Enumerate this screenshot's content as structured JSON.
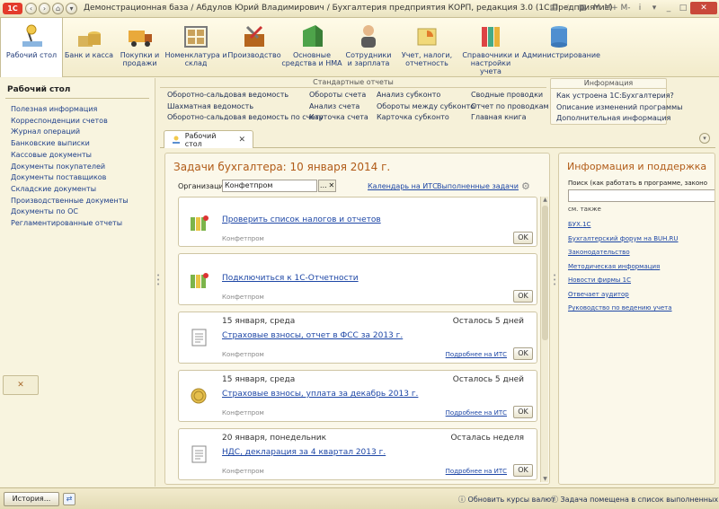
{
  "window": {
    "title": "Демонстрационная база / Абдулов Юрий Владимирович / Бухгалтерия предприятия КОРП, редакция 3.0  (1С:Предприятие)",
    "logo": "1С"
  },
  "sections": [
    {
      "label": "Рабочий стол",
      "icon": "desk-lamp-icon"
    },
    {
      "label": "Банк и касса",
      "icon": "bank-icon"
    },
    {
      "label": "Покупки и продажи",
      "icon": "truck-icon"
    },
    {
      "label": "Номенклатура и склад",
      "icon": "warehouse-icon"
    },
    {
      "label": "Производство",
      "icon": "tools-icon"
    },
    {
      "label": "Основные средства и НМА",
      "icon": "building-icon"
    },
    {
      "label": "Сотрудники и зарплата",
      "icon": "employee-icon"
    },
    {
      "label": "Учет, налоги, отчетность",
      "icon": "pie-chart-icon"
    },
    {
      "label": "Справочники и настройки учета",
      "icon": "books-icon"
    },
    {
      "label": "Администрирование",
      "icon": "database-icon"
    }
  ],
  "left_panel": {
    "title": "Рабочий стол",
    "items": [
      "Полезная информация",
      "Корреспонденции счетов",
      "Журнал операций",
      "Банковские выписки",
      "Кассовые документы",
      "Документы покупателей",
      "Документы поставщиков",
      "Складские документы",
      "Производственные документы",
      "Документы по ОС",
      "Регламентированные отчеты"
    ],
    "close_glyph": "✕"
  },
  "reports": {
    "title": "Стандартные отчеты",
    "col1": [
      "Оборотно-сальдовая ведомость",
      "Шахматная ведомость",
      "Оборотно-сальдовая ведомость по счету"
    ],
    "col2": [
      "Обороты счета",
      "Анализ счета",
      "Карточка счета"
    ],
    "col3": [
      "Анализ субконто",
      "Обороты между субконто",
      "Карточка субконто"
    ],
    "col4": [
      "Сводные проводки",
      "Отчет по проводкам",
      "Главная книга"
    ]
  },
  "info": {
    "title": "Информация",
    "items": [
      "Как устроена 1С:Бухгалтерия?",
      "Описание изменений программы",
      "Дополнительная информация"
    ]
  },
  "tab": {
    "label": "Рабочий стол",
    "close": "✕"
  },
  "tasks": {
    "title": "Задачи бухгалтера: 10 января 2014 г.",
    "org_label": "Организация:",
    "org_value": "Конфетпром",
    "calendar_link": "Календарь на ИТС",
    "done_link": "Выполненные задачи",
    "cards": [
      {
        "date": "",
        "remaining": "",
        "title": "Проверить список налогов и отчетов",
        "org": "Конфетпром",
        "more": "",
        "ok": "OK",
        "icon": "binders-icon"
      },
      {
        "date": "",
        "remaining": "",
        "title": "Подключиться к 1С-Отчетности",
        "org": "Конфетпром",
        "more": "",
        "ok": "OK",
        "icon": "binders-icon"
      },
      {
        "date": "15 января, среда",
        "remaining": "Осталось 5 дней",
        "title": "Страховые взносы, отчет в ФСС за 2013 г.",
        "org": "Конфетпром",
        "more": "Подробнее на ИТС",
        "ok": "OK",
        "icon": "document-icon"
      },
      {
        "date": "15 января, среда",
        "remaining": "Осталось 5 дней",
        "title": "Страховые взносы, уплата за декабрь 2013 г.",
        "org": "Конфетпром",
        "more": "Подробнее на ИТС",
        "ok": "OK",
        "icon": "coin-icon"
      },
      {
        "date": "20 января, понедельник",
        "remaining": "Осталась неделя",
        "title": "НДС, декларация за 4 квартал 2013 г.",
        "org": "Конфетпром",
        "more": "Подробнее на ИТС",
        "ok": "OK",
        "icon": "document-icon"
      }
    ]
  },
  "support": {
    "title": "Информация и поддержка",
    "search_label": "Поиск (как работать в программе, законо",
    "see_also": "см. также",
    "links": [
      "БУХ.1С",
      "Бухгалтерский форум на BUH.RU",
      "Законодательство",
      "Методическая информация",
      "Новости фирмы 1С",
      "Отвечает аудитор",
      "Руководство по ведению учета"
    ]
  },
  "statusbar": {
    "history": "История...",
    "update_rates": "Обновить курсы валют",
    "task_done": "Задача помещена в список выполненных"
  },
  "colors": {
    "accent": "#b15b17",
    "link": "#1e47a6",
    "background": "#f6f1d9"
  }
}
